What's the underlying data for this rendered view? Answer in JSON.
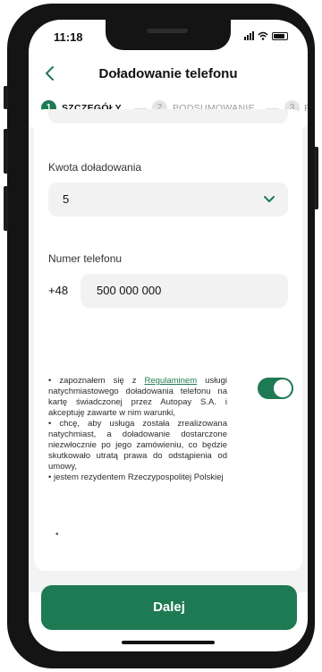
{
  "status_bar": {
    "time": "11:18"
  },
  "header": {
    "title": "Doładowanie telefonu",
    "back_icon": "chevron-left-icon"
  },
  "stepper": {
    "steps": [
      {
        "number": "1",
        "label": "SZCZEGÓŁY",
        "active": true
      },
      {
        "number": "2",
        "label": "PODSUMOWANIE",
        "active": false
      },
      {
        "number": "3",
        "label": "P",
        "active": false
      }
    ]
  },
  "form": {
    "amount": {
      "label": "Kwota doładowania",
      "value": "5"
    },
    "phone": {
      "label": "Numer telefonu",
      "prefix": "+48",
      "value": "500 000 000"
    }
  },
  "consent": {
    "line1_pre": "• zapoznałem się z ",
    "link": "Regulaminem",
    "line1_post": " usługi natychmiastowego doładowania telefonu na kartę świadczonej przez Autopay S.A. i akceptuję zawarte w nim warunki,",
    "line2": "• chcę, aby usługa została zrealizowana natychmiast, a doładowanie dostarczone niezwłocznie po jego zamówieniu, co będzie skutkowało utratą prawa do odstąpienia od umowy,",
    "line3": "• jestem rezydentem Rzeczypospolitej Polskiej",
    "extra_bullet": "•",
    "toggle_on": true
  },
  "actions": {
    "next_label": "Dalej"
  },
  "colors": {
    "accent": "#1e7a52",
    "field_bg": "#f2f2f2",
    "page_bg": "#f3f3f3"
  }
}
